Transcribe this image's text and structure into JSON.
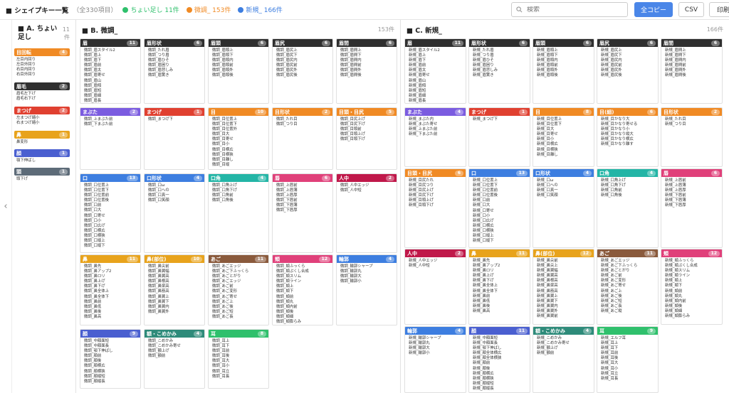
{
  "title": "■ シェイプキー一覧",
  "total": "（全330項目）",
  "legend": [
    {
      "text": "ちょい足し 11件",
      "color": "#2fc06c"
    },
    {
      "text": "微調_ 153件",
      "color": "#f08a24"
    },
    {
      "text": "新規_ 166件",
      "color": "#3d7ee0"
    }
  ],
  "search_placeholder": "検索",
  "buttons": {
    "copy_all": "全コピー",
    "csv": "CSV",
    "print": "印刷"
  },
  "handle": "‹",
  "colA": {
    "title": "■  A. ちょい足し",
    "count": "11件",
    "groups": [
      {
        "name": "目回転",
        "count": "4",
        "color": "#f08a24",
        "items": [
          "左目内回り",
          "左目外回り",
          "右目内回り",
          "右目外回り"
        ]
      },
      {
        "name": "眉毛",
        "count": "2",
        "color": "#2f2f2f",
        "items": [
          "眉毛左下げ",
          "眉毛右下げ"
        ]
      },
      {
        "name": "まつげ",
        "count": "2",
        "color": "#e04030",
        "items": [
          "左まつげ縮小",
          "右まつげ縮小"
        ]
      },
      {
        "name": "鼻",
        "count": "1",
        "color": "#e8a31c",
        "items": [
          "鼻変形"
        ]
      },
      {
        "name": "顔",
        "count": "1",
        "color": "#4a5fd0",
        "items": [
          "顎下伸ばし"
        ]
      },
      {
        "name": "頭",
        "count": "1",
        "color": "#5d6b78",
        "items": [
          "頭下げ"
        ]
      }
    ]
  },
  "colB": {
    "title": "■  B. 微調_",
    "count": "153件",
    "cards": [
      {
        "name": "眉",
        "count": "11",
        "color": "#2f2f2f",
        "items": [
          "微調_眉スタイル2",
          "微調_眉上",
          "微調_眉下",
          "微調_眉前",
          "微調_眉太",
          "微調_眉寄せ",
          "微調_眉山",
          "微調_眉傾",
          "微調_眉短",
          "微調_眉細",
          "微調_眉長"
        ]
      },
      {
        "name": "眉形状",
        "count": "6",
        "color": "#2f2f2f",
        "items": [
          "微調_たれ眉",
          "微調_つり眉",
          "微調_眉ひそ",
          "微調_眉困り",
          "微調_眉悲しみ",
          "微調_眉驚き"
        ]
      },
      {
        "name": "眉頭",
        "count": "6",
        "color": "#2f2f2f",
        "items": [
          "微調_眉頭上",
          "微調_眉頭下",
          "微調_眉頭内",
          "微調_眉頭前",
          "微調_眉頭外",
          "微調_眉頭後"
        ]
      },
      {
        "name": "眉尻",
        "count": "6",
        "color": "#2f2f2f",
        "items": [
          "微調_眉尻上",
          "微調_眉尻下",
          "微調_眉尻内",
          "微調_眉尻前",
          "微調_眉尻外",
          "微調_眉尻後"
        ]
      },
      {
        "name": "眉間",
        "count": "6",
        "color": "#2f2f2f",
        "items": [
          "微調_眉間上",
          "微調_眉間下",
          "微調_眉間内",
          "微調_眉間前",
          "微調_眉間外",
          "微調_眉間後"
        ]
      },
      {
        "name": "まぶた",
        "count": "2",
        "color": "#7b5ce0",
        "items": [
          "微調_上まぶた前",
          "微調_下まぶた前"
        ]
      },
      {
        "name": "まつげ",
        "count": "1",
        "color": "#e04030",
        "items": [
          "微調_まつげ下"
        ]
      },
      {
        "name": "目",
        "count": "10",
        "color": "#f08a24",
        "items": [
          "微調_目位置上",
          "微調_目位置下",
          "微調_目位置外",
          "微調_目大",
          "微調_目寄せ",
          "微調_目小",
          "微調_目横広",
          "微調_目横狭",
          "微調_目離し",
          "微調_目縦"
        ]
      },
      {
        "name": "目形状",
        "count": "2",
        "color": "#f08a24",
        "items": [
          "微調_たれ目",
          "微調_つり目"
        ]
      },
      {
        "name": "目頭・目尻",
        "count": "5",
        "color": "#f08a24",
        "items": [
          "微調_目尻上げ",
          "微調_目尻下げ",
          "微調_目頭前",
          "微調_目頭上げ",
          "微調_目頭下げ"
        ]
      },
      {
        "name": "口",
        "count": "13",
        "color": "#3d7ee0",
        "items": [
          "微調_口位置上",
          "微調_口位置下",
          "微調_口位置前",
          "微調_口位置後",
          "微調_口前",
          "微調_口大",
          "微調_口寄せ",
          "微調_口小",
          "微調_口広げ",
          "微調_口横広",
          "微調_口横狭",
          "微調_口縦上",
          "微調_口縦下"
        ]
      },
      {
        "name": "口形状",
        "count": "4",
        "color": "#3d7ee0",
        "items": [
          "微調_口ω",
          "微調_口への",
          "微調_口真一",
          "微調_口笑顔"
        ]
      },
      {
        "name": "口角",
        "count": "4",
        "color": "#23b5a6",
        "items": [
          "微調_口角上げ",
          "微調_口角下げ",
          "微調_口角前",
          "微調_口角後"
        ]
      },
      {
        "name": "唇",
        "count": "6",
        "color": "#e0407a",
        "items": [
          "微調_上唇前",
          "微調_上唇薄",
          "微調_上唇厚",
          "微調_下唇前",
          "微調_下唇薄",
          "微調_下唇厚"
        ]
      },
      {
        "name": "人中",
        "count": "2",
        "color": "#c0184a",
        "items": [
          "微調_人中エッジ",
          "微調_人中短"
        ]
      },
      {
        "name": "鼻",
        "count": "11",
        "color": "#e8a31c",
        "items": [
          "微調_鼻先",
          "微調_鼻アップ2",
          "微調_鼻ロリ",
          "微調_鼻上げ",
          "微調_鼻下げ",
          "微調_鼻全体上",
          "微調_鼻全体下",
          "微調_鼻前",
          "微調_鼻低",
          "微調_鼻後",
          "微調_鼻高"
        ]
      },
      {
        "name": "鼻(部位)",
        "count": "10",
        "color": "#e8a31c",
        "items": [
          "微調_鼻尖前",
          "微調_鼻翼幅",
          "微調_鼻翼高",
          "微調_鼻根高",
          "微調_鼻梁高",
          "微調_鼻筋高",
          "微調_鼻翼上",
          "微調_鼻翼下",
          "微調_鼻翼内",
          "微調_鼻翼外"
        ]
      },
      {
        "name": "あご",
        "count": "11",
        "color": "#8a5a3c",
        "items": [
          "微調_あごエッジ",
          "微調_あご下ふっくら",
          "微調_あごとがり",
          "微調_あごエッジ",
          "微調_あご前",
          "微調_あご変形",
          "微調_あご寄せ",
          "微調_あご上",
          "微調_あご後",
          "微調_あご短",
          "微調_あご長"
        ]
      },
      {
        "name": "頬",
        "count": "12",
        "color": "#e0407a",
        "items": [
          "微調_頬ふっくら",
          "微調_頬ぷくし合成",
          "微調_頬スリム",
          "微調_頬ライン",
          "微調_頬上",
          "微調_頬下",
          "微調_頬前",
          "微調_頬丸",
          "微調_頬内前",
          "微調_頬後",
          "微調_頬細",
          "微調_頬膨らみ"
        ]
      },
      {
        "name": "輪郭",
        "count": "4",
        "color": "#3d7ee0",
        "items": [
          "微調_輪郭シャープ",
          "微調_輪郭丸",
          "微調_輪郭大",
          "微調_輪郭小"
        ]
      },
      {
        "name": "顔",
        "count": "9",
        "color": "#4a5fd0",
        "items": [
          "微調_中顔面短",
          "微調_中顔面長",
          "微調_顎下伸ばし",
          "微調_顔前",
          "微調_顔後",
          "微調_顔横広",
          "微調_顔横狭",
          "微調_顔縦短",
          "微調_顔縦長"
        ]
      },
      {
        "name": "額・こめかみ",
        "count": "4",
        "color": "#2e8b7a",
        "items": [
          "微調_こめかみ",
          "微調_こめかみ寄せ",
          "微調_額上げ",
          "微調_額前"
        ]
      },
      {
        "name": "耳",
        "count": "8",
        "color": "#2fc06c",
        "items": [
          "微調_耳上",
          "微調_耳下",
          "微調_耳前",
          "微調_耳後",
          "微調_耳大",
          "微調_耳小",
          "微調_耳立",
          "微調_耳長"
        ]
      }
    ]
  },
  "colC": {
    "title": "■  C. 新規_",
    "count": "166件",
    "cards": [
      {
        "name": "眉",
        "count": "11",
        "color": "#2f2f2f",
        "items": [
          "新規_眉スタイル2",
          "新規_眉上",
          "新規_眉下",
          "新規_眉前",
          "新規_眉太",
          "新規_眉寄せ",
          "新規_眉山",
          "新規_眉傾",
          "新規_眉短",
          "新規_眉細",
          "新規_眉長"
        ]
      },
      {
        "name": "眉形状",
        "count": "6",
        "color": "#2f2f2f",
        "items": [
          "新規_たれ眉",
          "新規_つり眉",
          "新規_眉ひそ",
          "新規_眉困り",
          "新規_眉悲しみ",
          "新規_眉驚き"
        ]
      },
      {
        "name": "眉頭",
        "count": "6",
        "color": "#2f2f2f",
        "items": [
          "新規_眉頭上",
          "新規_眉頭下",
          "新規_眉頭内",
          "新規_眉頭前",
          "新規_眉頭外",
          "新規_眉頭後"
        ]
      },
      {
        "name": "眉尻",
        "count": "6",
        "color": "#2f2f2f",
        "items": [
          "新規_眉尻上",
          "新規_眉尻下",
          "新規_眉尻内",
          "新規_眉尻前",
          "新規_眉尻外",
          "新規_眉尻後"
        ]
      },
      {
        "name": "眉間",
        "count": "6",
        "color": "#2f2f2f",
        "items": [
          "新規_眉間上",
          "新規_眉間下",
          "新規_眉間内",
          "新規_眉間前",
          "新規_眉間外",
          "新規_眉間後"
        ]
      },
      {
        "name": "まぶた",
        "count": "4",
        "color": "#7b5ce0",
        "items": [
          "新規_まぶた内",
          "新規_まぶた寄せ",
          "新規_上まぶた前",
          "新規_下まぶた前"
        ]
      },
      {
        "name": "まつげ",
        "count": "1",
        "color": "#e04030",
        "items": [
          "新規_まつげ下"
        ]
      },
      {
        "name": "目",
        "count": "8",
        "color": "#f08a24",
        "items": [
          "新規_目位置上",
          "新規_目位置下",
          "新規_目大",
          "新規_目寄せ",
          "新規_目小",
          "新規_目横広",
          "新規_目横狭",
          "新規_目離し"
        ]
      },
      {
        "name": "目(細)",
        "count": "6",
        "color": "#f08a24",
        "items": [
          "新規_目かなり大",
          "新規_目かなり寄せる",
          "新規_目かなり小",
          "新規_目かなり縦大",
          "新規_目かなり横広",
          "新規_目かなり離す"
        ]
      },
      {
        "name": "目形状",
        "count": "2",
        "color": "#f08a24",
        "items": [
          "新規_たれ目",
          "新規_つり目"
        ]
      },
      {
        "name": "目頭・目尻",
        "count": "6",
        "color": "#f08a24",
        "items": [
          "新規_目尻たれ",
          "新規_目尻つり",
          "新規_目尻上げ",
          "新規_目尻下げ",
          "新規_目頭上げ",
          "新規_目頭下げ"
        ]
      },
      {
        "name": "口",
        "count": "13",
        "color": "#3d7ee0",
        "items": [
          "新規_口位置上",
          "新規_口位置下",
          "新規_口位置前",
          "新規_口位置後",
          "新規_口前",
          "新規_口大",
          "新規_口寄せ",
          "新規_口小",
          "新規_口広げ",
          "新規_口横広",
          "新規_口横狭",
          "新規_口縦上",
          "新規_口縦下"
        ]
      },
      {
        "name": "口形状",
        "count": "4",
        "color": "#3d7ee0",
        "items": [
          "新規_口ω",
          "新規_口への",
          "新規_口真一",
          "新規_口笑顔"
        ]
      },
      {
        "name": "口角",
        "count": "4",
        "color": "#23b5a6",
        "items": [
          "新規_口角上げ",
          "新規_口角下げ",
          "新規_口角前",
          "新規_口角後"
        ]
      },
      {
        "name": "唇",
        "count": "6",
        "color": "#e0407a",
        "items": [
          "新規_上唇前",
          "新規_上唇薄",
          "新規_上唇厚",
          "新規_下唇前",
          "新規_下唇薄",
          "新規_下唇厚"
        ]
      },
      {
        "name": "人中",
        "count": "2",
        "color": "#c0184a",
        "items": [
          "新規_人中エッジ",
          "新規_人中短"
        ]
      },
      {
        "name": "鼻",
        "count": "11",
        "color": "#e8a31c",
        "items": [
          "新規_鼻先",
          "新規_鼻アップ2",
          "新規_鼻ロリ",
          "新規_鼻上げ",
          "新規_鼻下げ",
          "新規_鼻全体上",
          "新規_鼻全体下",
          "新規_鼻前",
          "新規_鼻低",
          "新規_鼻後",
          "新規_鼻高"
        ]
      },
      {
        "name": "鼻(部位)",
        "count": "12",
        "color": "#e8a31c",
        "items": [
          "新規_鼻尖前",
          "新規_鼻尖上",
          "新規_鼻翼幅",
          "新規_鼻翼高",
          "新規_鼻根高",
          "新規_鼻梁高",
          "新規_鼻筋高",
          "新規_鼻翼上",
          "新規_鼻翼下",
          "新規_鼻翼内",
          "新規_鼻翼外",
          "新規_鼻翼前"
        ]
      },
      {
        "name": "あご",
        "count": "11",
        "color": "#8a5a3c",
        "items": [
          "新規_あごエッジ",
          "新規_あご下ふっくら",
          "新規_あごとがり",
          "新規_あご前",
          "新規_あご変形",
          "新規_あご寄せ",
          "新規_あご上",
          "新規_あご後",
          "新規_あご短",
          "新規_あご長",
          "新規_あご縦"
        ]
      },
      {
        "name": "頬",
        "count": "12",
        "color": "#e0407a",
        "items": [
          "新規_頬ふっくら",
          "新規_頬ぷくし合成",
          "新規_頬スリム",
          "新規_頬ライン",
          "新規_頬上",
          "新規_頬下",
          "新規_頬前",
          "新規_頬丸",
          "新規_頬内前",
          "新規_頬後",
          "新規_頬細",
          "新規_頬膨らみ"
        ]
      },
      {
        "name": "輪郭",
        "count": "4",
        "color": "#3d7ee0",
        "items": [
          "新規_輪郭シャープ",
          "新規_輪郭丸",
          "新規_輪郭大",
          "新規_輪郭小"
        ]
      },
      {
        "name": "顔",
        "count": "11",
        "color": "#4a5fd0",
        "items": [
          "新規_中顔面短",
          "新規_中顔面長",
          "新規_顎下伸ばし",
          "新規_顔全体横広",
          "新規_顔全体横狭",
          "新規_顔前",
          "新規_顔後",
          "新規_顔横広",
          "新規_顔横狭",
          "新規_顔縦短",
          "新規_顔縦長"
        ]
      },
      {
        "name": "額・こめかみ",
        "count": "4",
        "color": "#2e8b7a",
        "items": [
          "新規_こめかみ",
          "新規_こめかみ寄せ",
          "新規_額上げ",
          "新規_額前"
        ]
      },
      {
        "name": "耳",
        "count": "9",
        "color": "#2fc06c",
        "items": [
          "新規_エルフ耳",
          "新規_耳上",
          "新規_耳下",
          "新規_耳前",
          "新規_耳後",
          "新規_耳大",
          "新規_耳小",
          "新規_耳立",
          "新規_耳長"
        ]
      }
    ]
  }
}
